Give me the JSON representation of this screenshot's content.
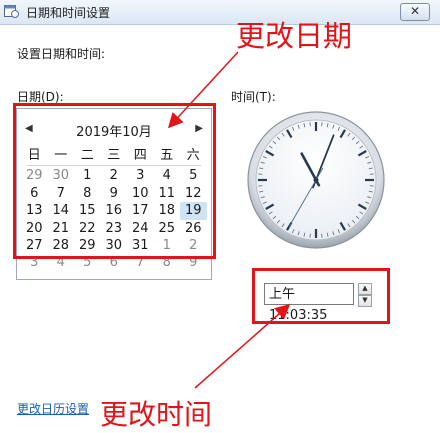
{
  "window": {
    "title": "日期和时间设置",
    "close_glyph": "✕"
  },
  "heading": "设置日期和时间:",
  "date_label": "日期(D):",
  "time_label": "时间(T):",
  "calendar": {
    "prev_glyph": "◀",
    "next_glyph": "▶",
    "month_title": "2019年10月",
    "weekdays": [
      "日",
      "一",
      "二",
      "三",
      "四",
      "五",
      "六"
    ],
    "weeks": [
      [
        {
          "d": "29",
          "o": true
        },
        {
          "d": "30",
          "o": true
        },
        {
          "d": "1"
        },
        {
          "d": "2"
        },
        {
          "d": "3"
        },
        {
          "d": "4"
        },
        {
          "d": "5"
        }
      ],
      [
        {
          "d": "6"
        },
        {
          "d": "7"
        },
        {
          "d": "8"
        },
        {
          "d": "9"
        },
        {
          "d": "10"
        },
        {
          "d": "11"
        },
        {
          "d": "12"
        }
      ],
      [
        {
          "d": "13"
        },
        {
          "d": "14"
        },
        {
          "d": "15"
        },
        {
          "d": "16"
        },
        {
          "d": "17"
        },
        {
          "d": "18"
        },
        {
          "d": "19",
          "today": true
        }
      ],
      [
        {
          "d": "20"
        },
        {
          "d": "21"
        },
        {
          "d": "22"
        },
        {
          "d": "23"
        },
        {
          "d": "24"
        },
        {
          "d": "25"
        },
        {
          "d": "26"
        }
      ],
      [
        {
          "d": "27"
        },
        {
          "d": "28"
        },
        {
          "d": "29"
        },
        {
          "d": "30"
        },
        {
          "d": "31"
        },
        {
          "d": "1",
          "o": true
        },
        {
          "d": "2",
          "o": true
        }
      ],
      [
        {
          "d": "3",
          "o": true
        },
        {
          "d": "4",
          "o": true
        },
        {
          "d": "5",
          "o": true
        },
        {
          "d": "6",
          "o": true
        },
        {
          "d": "7",
          "o": true
        },
        {
          "d": "8",
          "o": true
        },
        {
          "d": "9",
          "o": true
        }
      ]
    ]
  },
  "clock": {
    "hour": 11,
    "minute": 3,
    "second": 35
  },
  "time_value": "上午 11:03:35",
  "spin_up": "▲",
  "spin_down": "▼",
  "annotations": {
    "change_date": "更改日期",
    "change_time": "更改时间"
  },
  "calendar_settings_link": "更改日历设置",
  "colors": {
    "annotation_red": "#e31418",
    "link_blue": "#1a5fb4"
  }
}
